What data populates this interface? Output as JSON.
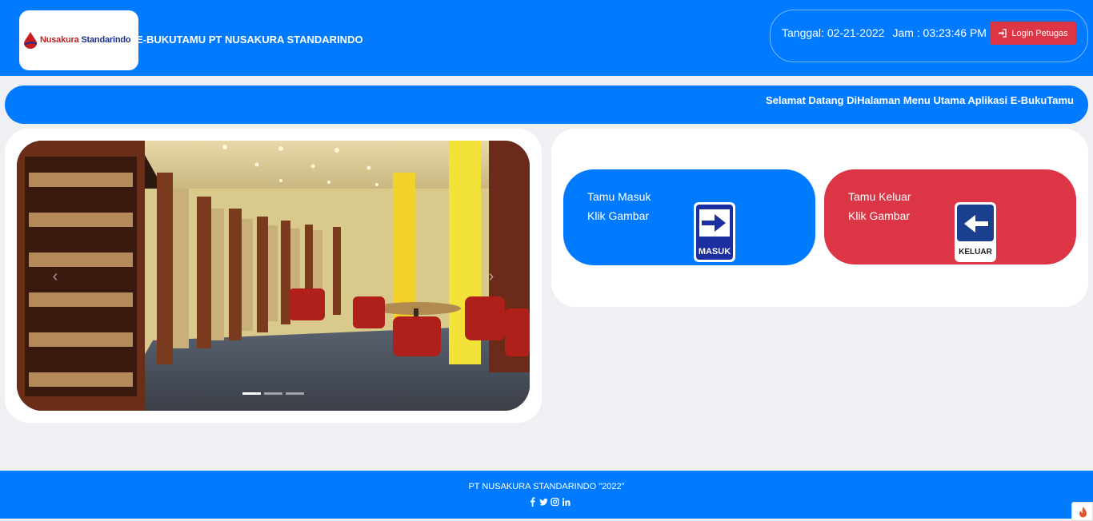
{
  "header": {
    "logo_text_1": "Nusakura",
    "logo_text_2": "Standarindo",
    "app_title": "E-BUKUTAMU PT NUSAKURA STANDARINDO",
    "date_label": "Tanggal: 02-21-2022",
    "time_label": "Jam : 03:23:46 PM",
    "login_label": "Login Petugas"
  },
  "marquee": {
    "text": "Selamat Datang DiHalaman Menu Utama Aplikasi E-BukuTamu"
  },
  "carousel": {
    "prev_icon": "chevron-left-icon",
    "next_icon": "chevron-right-icon",
    "slides": 3,
    "active": 0
  },
  "actions": {
    "masuk": {
      "line1": "Tamu Masuk",
      "line2": "Klik Gambar",
      "sign_text": "MASUK"
    },
    "keluar": {
      "line1": "Tamu Keluar",
      "line2": "Klik Gambar",
      "sign_text": "KELUAR"
    }
  },
  "footer": {
    "copyright": "PT NUSAKURA STANDARINDO \"2022\"",
    "icons": [
      "facebook-icon",
      "twitter-icon",
      "instagram-icon",
      "linkedin-icon"
    ]
  },
  "colors": {
    "primary": "#007bff",
    "danger": "#dc3545",
    "background": "#eef0f3"
  }
}
